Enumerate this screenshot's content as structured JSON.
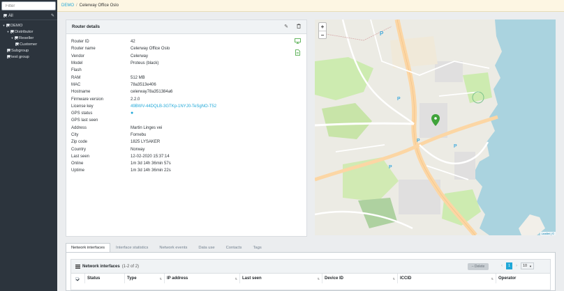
{
  "sidebar": {
    "filter_placeholder": "Filter",
    "all_label": "All",
    "tree": [
      {
        "label": "DEMO",
        "level": 0,
        "caret": true
      },
      {
        "label": "Distributor",
        "level": 1,
        "caret": true
      },
      {
        "label": "Reseller",
        "level": 2,
        "caret": true
      },
      {
        "label": "Customer",
        "level": 3,
        "caret": false
      },
      {
        "label": "Subgroup",
        "level": 1,
        "caret": false
      },
      {
        "label": "test group",
        "level": 1,
        "caret": false
      }
    ]
  },
  "breadcrumb": {
    "root": "DEMO",
    "separator": "/",
    "current": "Celerway Office Oslo"
  },
  "router_details": {
    "title": "Router details",
    "rows": [
      {
        "key": "Router ID",
        "value": "42",
        "style": ""
      },
      {
        "key": "Router name",
        "value": "Celerway Office Oslo",
        "style": ""
      },
      {
        "key": "Vendor",
        "value": "Celerway",
        "style": ""
      },
      {
        "key": "Model",
        "value": "Proteus (black)",
        "style": ""
      },
      {
        "key": "Flash",
        "value": "",
        "style": ""
      },
      {
        "key": "RAM",
        "value": "512 MB",
        "style": ""
      },
      {
        "key": "MAC",
        "value": "78a3513e406",
        "style": ""
      },
      {
        "key": "Hostname",
        "value": "celerway78a351384a6",
        "style": ""
      },
      {
        "key": "Firmware version",
        "value": "2.2.0",
        "style": ""
      },
      {
        "key": "License key",
        "value": "49BWV-44DQLB-3GTKp-1NYJ0-TeSgNO-T52",
        "style": "link"
      },
      {
        "key": "GPS status",
        "value": "●",
        "style": "dot"
      },
      {
        "key": "GPS last seen",
        "value": "",
        "style": ""
      },
      {
        "key": "Address",
        "value": "Martin Linges vei",
        "style": ""
      },
      {
        "key": "City",
        "value": "Fornebu",
        "style": ""
      },
      {
        "key": "Zip code",
        "value": "1825 LYSAKER",
        "style": ""
      },
      {
        "key": "Country",
        "value": "Norway",
        "style": ""
      },
      {
        "key": "Last seen",
        "value": "12-02-2020 15:37:14",
        "style": ""
      },
      {
        "key": "Online",
        "value": "1m 3d 14h 36min 57s",
        "style": ""
      },
      {
        "key": "Uptime",
        "value": "1m 3d 14h 36min 22s",
        "style": ""
      }
    ]
  },
  "map": {
    "zoom_in": "+",
    "zoom_out": "−",
    "attribution": "Leaflet | ©"
  },
  "tabs": [
    {
      "label": "Network interfaces",
      "active": true
    },
    {
      "label": "Interface statistics",
      "active": false
    },
    {
      "label": "Network events",
      "active": false
    },
    {
      "label": "Data use",
      "active": false
    },
    {
      "label": "Contacts",
      "active": false
    },
    {
      "label": "Tags",
      "active": false
    }
  ],
  "network_interfaces": {
    "title": "Network interfaces",
    "count": "(1-2 of 2)",
    "delete_label": "Delete",
    "page": "1",
    "page_size": "10",
    "columns": [
      "Status",
      "Type",
      "IP address",
      "Last seen",
      "Device ID",
      "ICCID",
      "Operator"
    ]
  },
  "colors": {
    "accent": "#20a8d8",
    "sidebar_bg": "#2c343d",
    "marker": "#3fa33a"
  }
}
